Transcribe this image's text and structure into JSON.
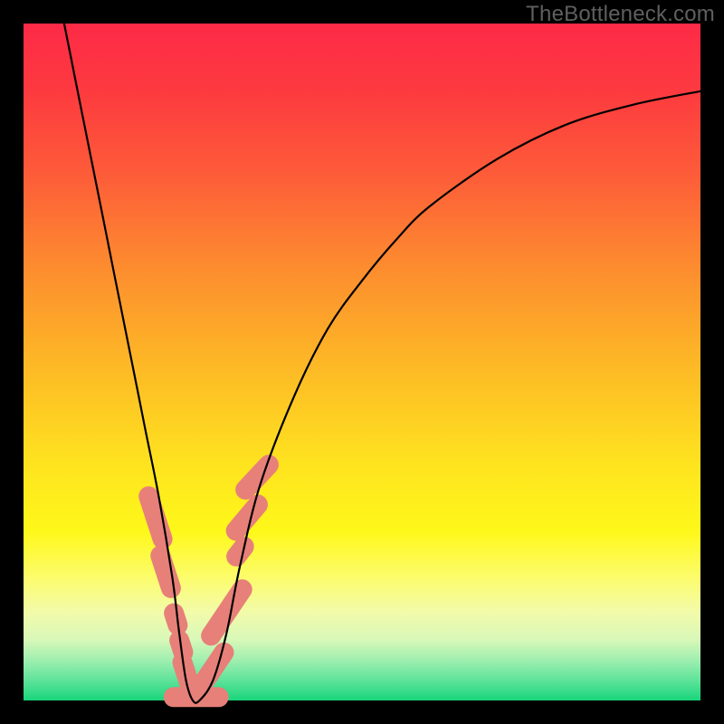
{
  "watermark": "TheBottleneck.com",
  "colors": {
    "gradient_top": "#fd2a47",
    "gradient_bottom": "#19d57c",
    "curve": "#000000",
    "blob": "#e78079",
    "frame": "#000000"
  },
  "chart_data": {
    "type": "line",
    "title": "",
    "xlabel": "",
    "ylabel": "",
    "xlim": [
      0,
      100
    ],
    "ylim": [
      0,
      100
    ],
    "grid": false,
    "series": [
      {
        "name": "bottleneck-curve",
        "x": [
          6,
          8,
          10,
          12,
          14,
          16,
          18,
          20,
          22,
          23,
          24,
          25,
          26,
          28,
          30,
          32,
          35,
          40,
          45,
          50,
          55,
          60,
          70,
          80,
          90,
          100
        ],
        "y": [
          100,
          90,
          80,
          70,
          60,
          50,
          40,
          30,
          18,
          10,
          3,
          0,
          0,
          3,
          10,
          20,
          32,
          45,
          55,
          62,
          68,
          73,
          80,
          85,
          88,
          90
        ]
      }
    ],
    "annotations": [
      {
        "name": "blob-left-upper",
        "x": 19.5,
        "y": 27,
        "length": 6,
        "angle_deg": 72
      },
      {
        "name": "blob-left-mid",
        "x": 21.0,
        "y": 19,
        "length": 5,
        "angle_deg": 72
      },
      {
        "name": "blob-left-small1",
        "x": 22.5,
        "y": 12,
        "length": 3,
        "angle_deg": 72
      },
      {
        "name": "blob-left-small2",
        "x": 23.3,
        "y": 8,
        "length": 3,
        "angle_deg": 72
      },
      {
        "name": "blob-left-lower",
        "x": 24.0,
        "y": 4,
        "length": 4,
        "angle_deg": 72
      },
      {
        "name": "blob-bottom",
        "x": 25.5,
        "y": 0.5,
        "length": 6,
        "angle_deg": 0
      },
      {
        "name": "blob-right-lower",
        "x": 28.2,
        "y": 5,
        "length": 5,
        "angle_deg": -56
      },
      {
        "name": "blob-right-mid1",
        "x": 30.0,
        "y": 13,
        "length": 7,
        "angle_deg": -56
      },
      {
        "name": "blob-right-small",
        "x": 32.0,
        "y": 22,
        "length": 3,
        "angle_deg": -52
      },
      {
        "name": "blob-right-mid2",
        "x": 33.0,
        "y": 27,
        "length": 5,
        "angle_deg": -50
      },
      {
        "name": "blob-right-upper",
        "x": 34.5,
        "y": 33,
        "length": 5,
        "angle_deg": -47
      }
    ]
  }
}
